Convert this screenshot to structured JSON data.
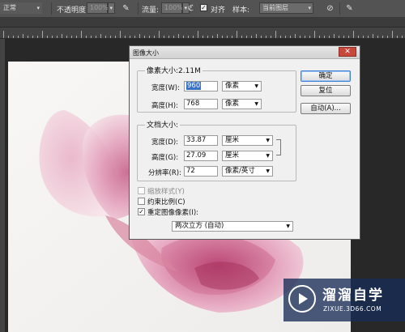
{
  "optionsBar": {
    "mode_value": "正常",
    "opacity_label": "不透明度:",
    "opacity_value": "100%",
    "flow_label": "流量:",
    "flow_value": "100%",
    "align_label": "对齐",
    "sample_label": "样本:",
    "sample_value": "当前图层"
  },
  "dialog": {
    "title": "图像大小",
    "close_glyph": "✕",
    "pixel_dimensions": {
      "label": "像素大小:2.11M",
      "width_label": "宽度(W):",
      "width_value": "960",
      "width_unit": "像素",
      "height_label": "高度(H):",
      "height_value": "768",
      "height_unit": "像素"
    },
    "document_size": {
      "label": "文档大小:",
      "width_label": "宽度(D):",
      "width_value": "33.87",
      "width_unit": "厘米",
      "height_label": "高度(G):",
      "height_value": "27.09",
      "height_unit": "厘米",
      "resolution_label": "分辨率(R):",
      "resolution_value": "72",
      "resolution_unit": "像素/英寸"
    },
    "options": {
      "scale_styles": "缩放样式(Y)",
      "constrain": "约束比例(C)",
      "resample": "重定图像像素(I):",
      "resample_method": "两次立方 (自动)"
    },
    "buttons": {
      "ok": "确定",
      "reset": "复位",
      "auto": "自动(A)..."
    }
  },
  "watermark": {
    "name": "溜溜自学",
    "url": "ZIXUE.3D66.COM"
  }
}
